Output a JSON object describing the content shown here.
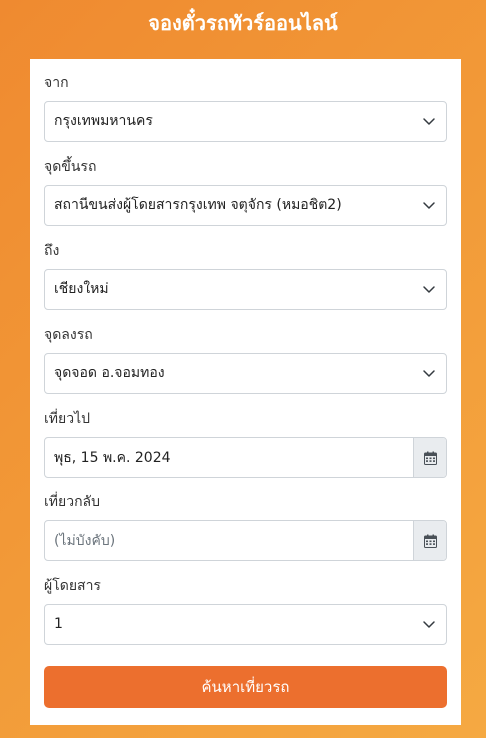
{
  "header": {
    "title": "จองตั๋วรถทัวร์ออนไลน์"
  },
  "form": {
    "origin": {
      "label": "จาก",
      "value": "กรุงเทพมหานคร"
    },
    "pickup": {
      "label": "จุดขึ้นรถ",
      "value": "สถานีขนส่งผู้โดยสารกรุงเทพ จตุจักร (หมอชิต2)"
    },
    "destination": {
      "label": "ถึง",
      "value": "เชียงใหม่"
    },
    "dropoff": {
      "label": "จุดลงรถ",
      "value": "จุดจอด อ.จอมทอง"
    },
    "depart_date": {
      "label": "เที่ยวไป",
      "value": "พุธ, 15 พ.ค. 2024",
      "placeholder": ""
    },
    "return_date": {
      "label": "เที่ยวกลับ",
      "value": "",
      "placeholder": "(ไม่บังคับ)"
    },
    "passengers": {
      "label": "ผู้โดยสาร",
      "value": "1"
    },
    "search_label": "ค้นหาเที่ยวรถ"
  },
  "icons": {
    "select_arrow": "chevron-down-icon",
    "date_picker": "calendar-icon"
  },
  "colors": {
    "background": "#f29a38",
    "button": "#ec6f2e",
    "addon": "#e9ecef"
  }
}
